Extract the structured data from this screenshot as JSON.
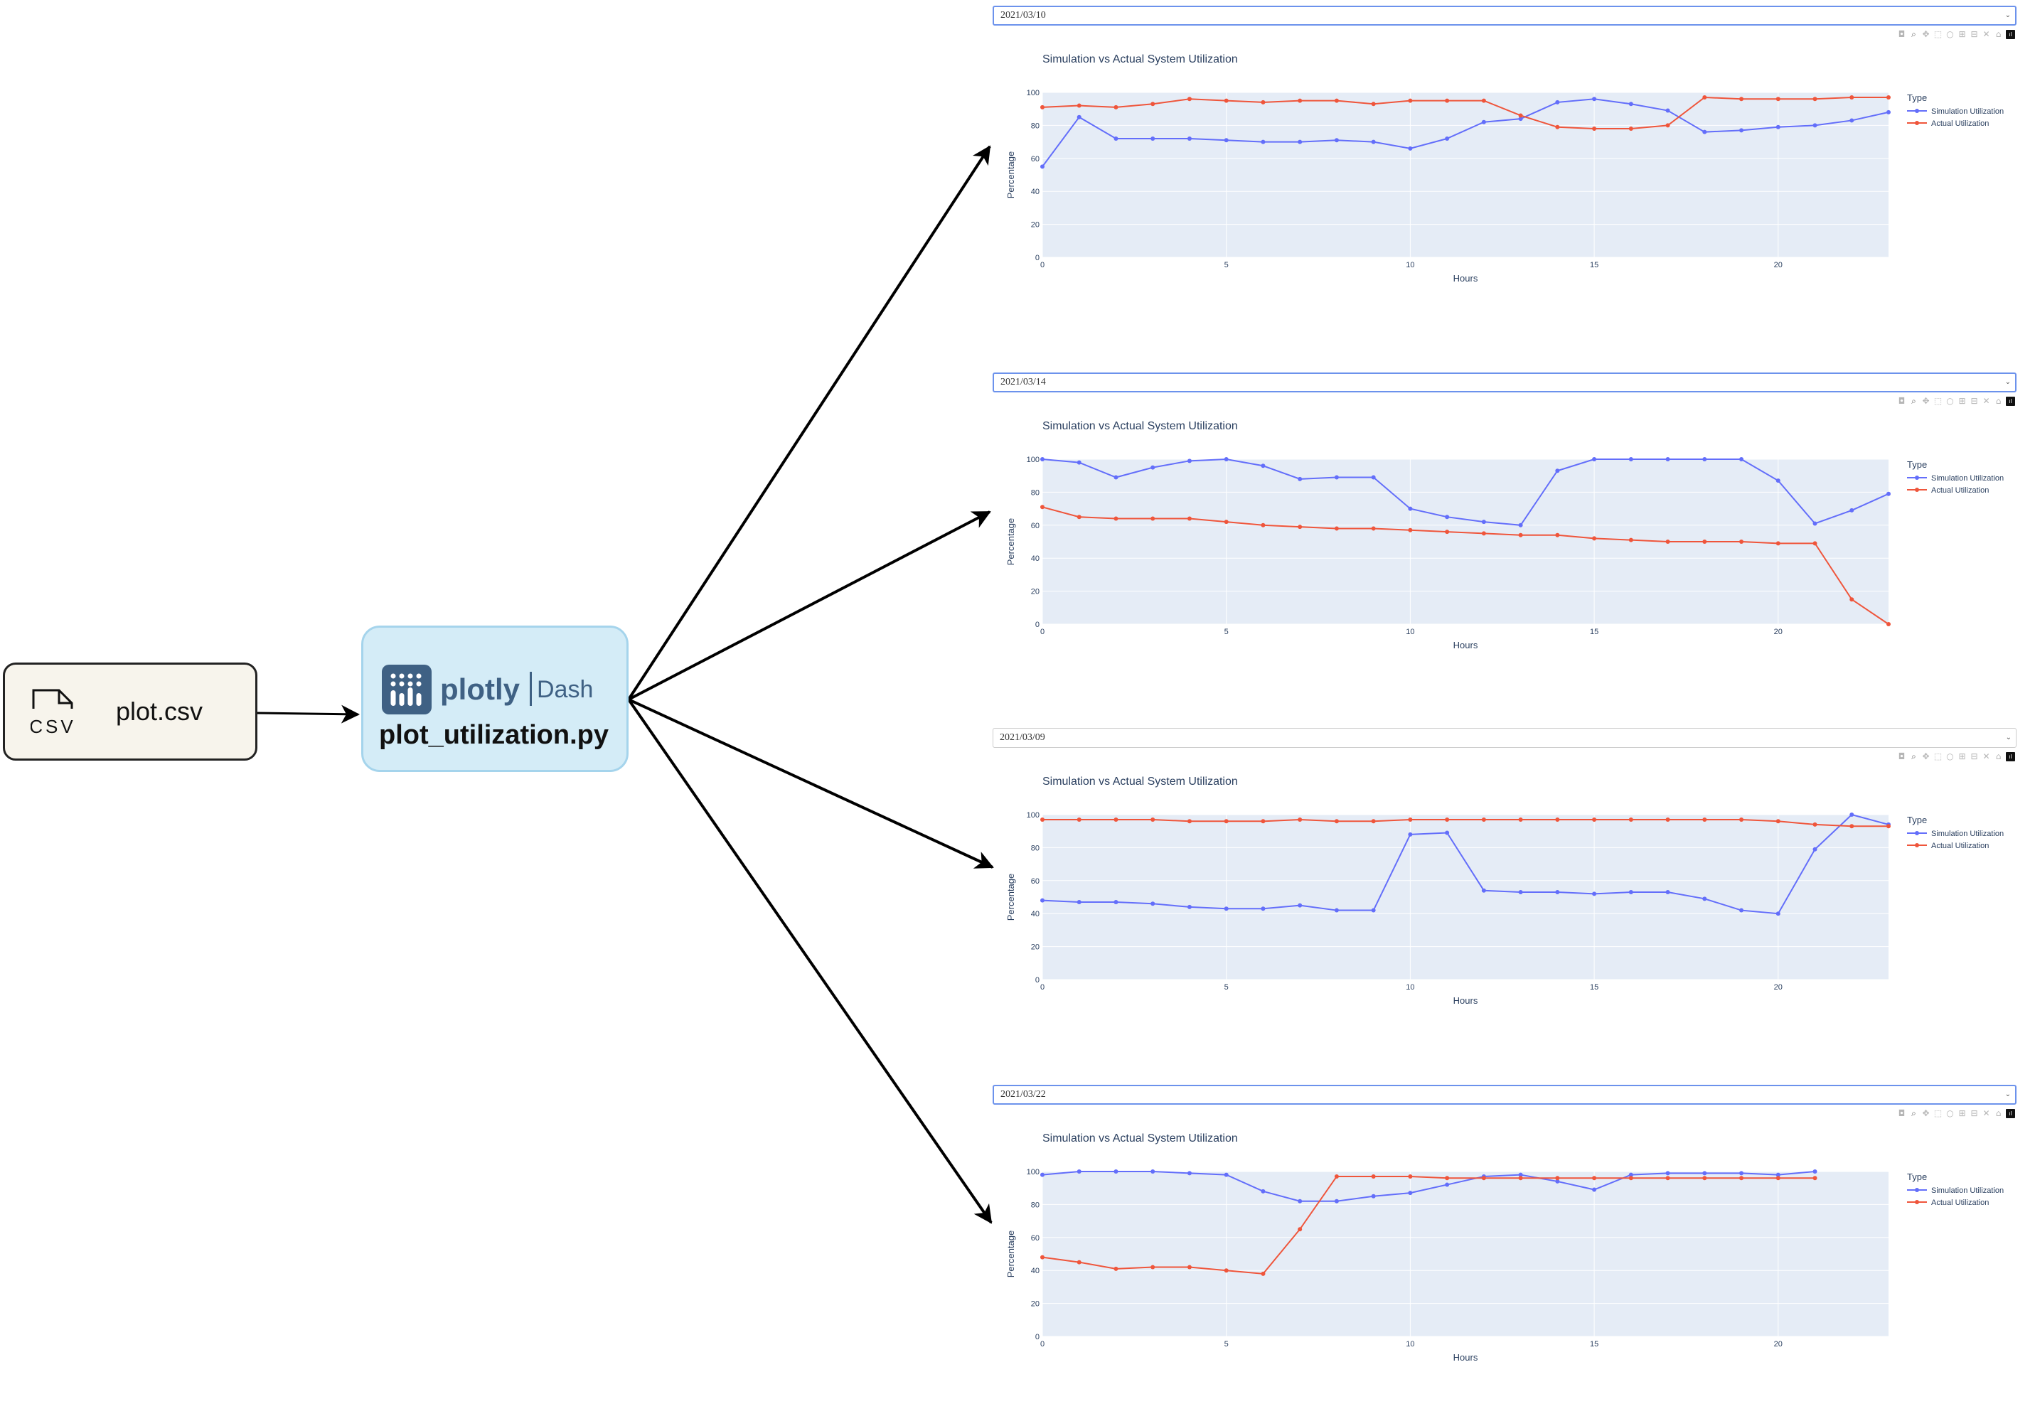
{
  "diagram": {
    "csv_node": {
      "icon_text": "CSV",
      "label": "plot.csv"
    },
    "dash_node": {
      "brand": "plotly",
      "product": "Dash",
      "script": "plot_utilization.py"
    }
  },
  "modebar_icons": [
    "camera-icon",
    "zoom-icon",
    "pan-icon",
    "box-select-icon",
    "lasso-icon",
    "zoom-in-icon",
    "zoom-out-icon",
    "autoscale-icon",
    "reset-axes-icon",
    "plotly-logo-icon"
  ],
  "colors": {
    "simulation": "#636efa",
    "actual": "#ef553b",
    "plot_bg": "#e5ecf6",
    "title": "#2a3f5f"
  },
  "chart_data": [
    {
      "type": "line",
      "date": "2021/03/10",
      "title": "Simulation vs Actual System Utilization",
      "xlabel": "Hours",
      "ylabel": "Percentage",
      "xlim": [
        0,
        23
      ],
      "ylim": [
        0,
        100
      ],
      "x_ticks": [
        0,
        5,
        10,
        15,
        20
      ],
      "y_ticks": [
        0,
        20,
        40,
        60,
        80,
        100
      ],
      "legend_title": "Type",
      "legend_position": "top-right",
      "series": [
        {
          "name": "Simulation Utilization",
          "x": [
            0,
            1,
            2,
            3,
            4,
            5,
            6,
            7,
            8,
            9,
            10,
            11,
            12,
            13,
            14,
            15,
            16,
            17,
            18,
            19,
            20,
            21,
            22,
            23
          ],
          "values": [
            55,
            85,
            72,
            72,
            72,
            71,
            70,
            70,
            71,
            70,
            66,
            72,
            82,
            84,
            94,
            96,
            93,
            89,
            76,
            77,
            79,
            80,
            83,
            88
          ]
        },
        {
          "name": "Actual Utilization",
          "x": [
            0,
            1,
            2,
            3,
            4,
            5,
            6,
            7,
            8,
            9,
            10,
            11,
            12,
            13,
            14,
            15,
            16,
            17,
            18,
            19,
            20,
            21,
            22,
            23
          ],
          "values": [
            91,
            92,
            91,
            93,
            96,
            95,
            94,
            95,
            95,
            93,
            95,
            95,
            95,
            86,
            79,
            78,
            78,
            80,
            97,
            96,
            96,
            96,
            97,
            97
          ]
        }
      ]
    },
    {
      "type": "line",
      "date": "2021/03/14",
      "title": "Simulation vs Actual System Utilization",
      "xlabel": "Hours",
      "ylabel": "Percentage",
      "xlim": [
        0,
        23
      ],
      "ylim": [
        0,
        100
      ],
      "x_ticks": [
        0,
        5,
        10,
        15,
        20
      ],
      "y_ticks": [
        0,
        20,
        40,
        60,
        80,
        100
      ],
      "legend_title": "Type",
      "legend_position": "top-right",
      "series": [
        {
          "name": "Simulation Utilization",
          "x": [
            0,
            1,
            2,
            3,
            4,
            5,
            6,
            7,
            8,
            9,
            10,
            11,
            12,
            13,
            14,
            15,
            16,
            17,
            18,
            19,
            20,
            21,
            22,
            23
          ],
          "values": [
            100,
            98,
            89,
            95,
            99,
            100,
            96,
            88,
            89,
            89,
            70,
            65,
            62,
            60,
            93,
            100,
            100,
            100,
            100,
            100,
            87,
            61,
            69,
            79
          ]
        },
        {
          "name": "Actual Utilization",
          "x": [
            0,
            1,
            2,
            3,
            4,
            5,
            6,
            7,
            8,
            9,
            10,
            11,
            12,
            13,
            14,
            15,
            16,
            17,
            18,
            19,
            20,
            21,
            22,
            23
          ],
          "values": [
            71,
            65,
            64,
            64,
            64,
            62,
            60,
            59,
            58,
            58,
            57,
            56,
            55,
            54,
            54,
            52,
            51,
            50,
            50,
            50,
            49,
            49,
            15,
            0
          ]
        }
      ]
    },
    {
      "type": "line",
      "date": "2021/03/09",
      "title": "Simulation vs Actual System Utilization",
      "xlabel": "Hours",
      "ylabel": "Percentage",
      "xlim": [
        0,
        23
      ],
      "ylim": [
        0,
        100
      ],
      "x_ticks": [
        0,
        5,
        10,
        15,
        20
      ],
      "y_ticks": [
        0,
        20,
        40,
        60,
        80,
        100
      ],
      "legend_title": "Type",
      "legend_position": "top-right",
      "series": [
        {
          "name": "Simulation Utilization",
          "x": [
            0,
            1,
            2,
            3,
            4,
            5,
            6,
            7,
            8,
            9,
            10,
            11,
            12,
            13,
            14,
            15,
            16,
            17,
            18,
            19,
            20,
            21,
            22,
            23
          ],
          "values": [
            48,
            47,
            47,
            46,
            44,
            43,
            43,
            45,
            42,
            42,
            88,
            89,
            54,
            53,
            53,
            52,
            53,
            53,
            49,
            42,
            40,
            79,
            100,
            94
          ]
        },
        {
          "name": "Actual Utilization",
          "x": [
            0,
            1,
            2,
            3,
            4,
            5,
            6,
            7,
            8,
            9,
            10,
            11,
            12,
            13,
            14,
            15,
            16,
            17,
            18,
            19,
            20,
            21,
            22,
            23
          ],
          "values": [
            97,
            97,
            97,
            97,
            96,
            96,
            96,
            97,
            96,
            96,
            97,
            97,
            97,
            97,
            97,
            97,
            97,
            97,
            97,
            97,
            96,
            94,
            93,
            93
          ]
        }
      ]
    },
    {
      "type": "line",
      "date": "2021/03/22",
      "title": "Simulation vs Actual System Utilization",
      "xlabel": "Hours",
      "ylabel": "Percentage",
      "xlim": [
        0,
        23
      ],
      "ylim": [
        0,
        100
      ],
      "x_ticks": [
        0,
        5,
        10,
        15,
        20
      ],
      "y_ticks": [
        0,
        20,
        40,
        60,
        80,
        100
      ],
      "legend_title": "Type",
      "legend_position": "top-right",
      "series": [
        {
          "name": "Simulation Utilization",
          "x": [
            0,
            1,
            2,
            3,
            4,
            5,
            6,
            7,
            8,
            9,
            10,
            11,
            12,
            13,
            14,
            15,
            16,
            17,
            18,
            19,
            20,
            21
          ],
          "values": [
            98,
            100,
            100,
            100,
            99,
            98,
            88,
            82,
            82,
            85,
            87,
            92,
            97,
            98,
            94,
            89,
            98,
            99,
            99,
            99,
            98,
            100
          ]
        },
        {
          "name": "Actual Utilization",
          "x": [
            0,
            1,
            2,
            3,
            4,
            5,
            6,
            7,
            8,
            9,
            10,
            11,
            12,
            13,
            14,
            15,
            16,
            17,
            18,
            19,
            20,
            21
          ],
          "values": [
            48,
            45,
            41,
            42,
            42,
            40,
            38,
            65,
            97,
            97,
            97,
            96,
            96,
            96,
            96,
            96,
            96,
            96,
            96,
            96,
            96,
            96
          ]
        }
      ]
    }
  ]
}
